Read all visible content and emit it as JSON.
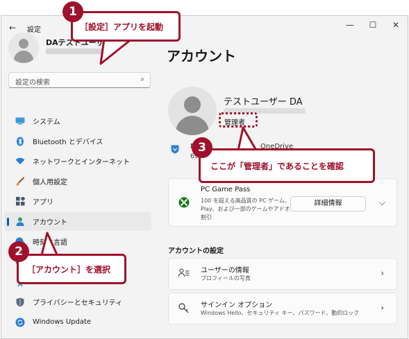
{
  "window": {
    "title": "設定",
    "back_glyph": "←",
    "min_glyph": "—",
    "max_glyph": "☐",
    "close_glyph": "✕"
  },
  "sidebar": {
    "user_name": "DAテストユーザー",
    "search_placeholder": "設定の検索",
    "items": [
      {
        "label": "システム",
        "icon": "monitor-icon",
        "color": "#3a9bd9"
      },
      {
        "label": "Bluetooth とデバイス",
        "icon": "bluetooth-icon",
        "color": "#2a7fd1"
      },
      {
        "label": "ネットワークとインターネット",
        "icon": "wifi-icon",
        "color": "#2a7fd1"
      },
      {
        "label": "個人用設定",
        "icon": "brush-icon",
        "color": "#d68a2f"
      },
      {
        "label": "アプリ",
        "icon": "apps-icon",
        "color": "#4a5a6a"
      },
      {
        "label": "アカウント",
        "icon": "person-icon",
        "color": "#2aa36b",
        "active": true
      },
      {
        "label": "時刻と言語",
        "icon": "clock-globe-icon",
        "color": "#2a7fd1"
      },
      {
        "label": "",
        "icon": "game-icon",
        "color": "#666666"
      },
      {
        "label": "",
        "icon": "accessibility-icon",
        "color": "#2a7fd1"
      },
      {
        "label": "プライバシーとセキュリティ",
        "icon": "shield-icon",
        "color": "#5a6a7a"
      },
      {
        "label": "Windows Update",
        "icon": "update-icon",
        "color": "#2a7fd1"
      }
    ]
  },
  "main": {
    "page_title": "アカウント",
    "account_name": "テストユーザー DA",
    "account_role": "管理者",
    "rewards_label": "M",
    "rewards_value": "69",
    "onedrive_label": "OneDrive",
    "game_pass": {
      "title": "PC Game Pass",
      "desc_lines": [
        "100 を超える高品質の PC ゲーム、EA",
        "Play、および一部のゲームやアドオンの",
        "割引"
      ],
      "button": "詳細情報"
    },
    "section_title": "アカウントの設定",
    "settings": [
      {
        "title": "ユーザーの情報",
        "subtitle": "プロフィールの写真"
      },
      {
        "title": "サインイン オプション",
        "subtitle": "Windows Hello、セキュリティ キー、パスワード、動的ロック"
      }
    ]
  },
  "annotations": [
    {
      "number": "1",
      "text": "［設定］アプリを起動"
    },
    {
      "number": "2",
      "text": "［アカウント］を選択"
    },
    {
      "number": "3",
      "text": "ここが「管理者」であることを確認"
    }
  ],
  "accent_color": "#005fb8",
  "callout_color": "#a0102a"
}
